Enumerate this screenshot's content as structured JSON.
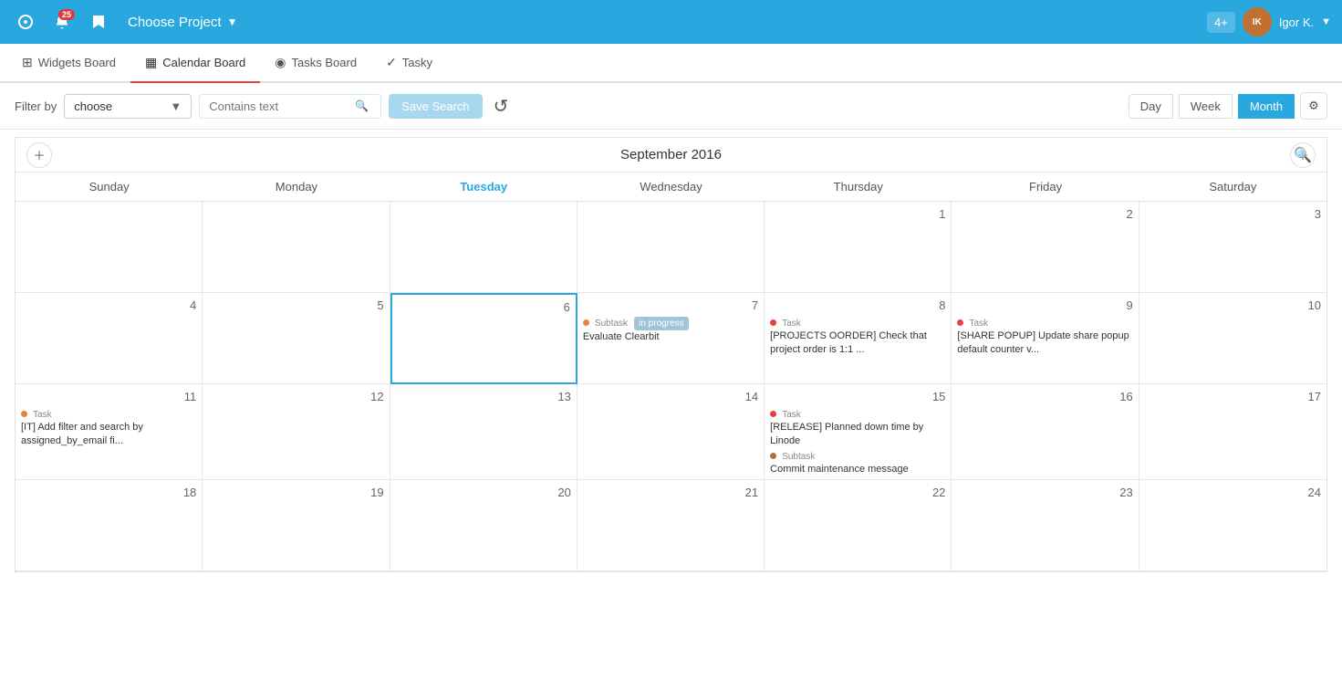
{
  "topNav": {
    "appIconLabel": "◎",
    "notificationIconLabel": "🔔",
    "notificationCount": "25",
    "bookmarkIconLabel": "🔖",
    "projectLabel": "Choose Project",
    "projectArrow": "▼",
    "plusLabel": "4+",
    "userName": "Igor K.",
    "userArrow": "▼"
  },
  "tabs": [
    {
      "id": "widgets",
      "label": "Widgets Board",
      "icon": "⊞",
      "active": false
    },
    {
      "id": "calendar",
      "label": "Calendar Board",
      "icon": "▦",
      "active": true
    },
    {
      "id": "tasks",
      "label": "Tasks Board",
      "icon": "◉",
      "active": false
    },
    {
      "id": "tasky",
      "label": "Tasky",
      "icon": "✓",
      "active": false
    }
  ],
  "filterBar": {
    "filterLabel": "Filter by",
    "filterValue": "choose",
    "searchPlaceholder": "Contains text",
    "saveSearchLabel": "Save Search",
    "viewButtons": [
      {
        "id": "day",
        "label": "Day",
        "active": false
      },
      {
        "id": "week",
        "label": "Week",
        "active": false
      },
      {
        "id": "month",
        "label": "Month",
        "active": true
      }
    ],
    "settingsIcon": "⚙"
  },
  "calendar": {
    "title": "September 2016",
    "dayHeaders": [
      "Sunday",
      "Monday",
      "Tuesday",
      "Wednesday",
      "Thursday",
      "Friday",
      "Saturday"
    ],
    "todayDayIndex": 2,
    "weeks": [
      [
        {
          "num": "",
          "tasks": []
        },
        {
          "num": "",
          "tasks": []
        },
        {
          "num": "",
          "tasks": []
        },
        {
          "num": "",
          "tasks": []
        },
        {
          "num": "1",
          "tasks": []
        },
        {
          "num": "2",
          "tasks": []
        },
        {
          "num": "3",
          "tasks": []
        }
      ],
      [
        {
          "num": "4",
          "tasks": []
        },
        {
          "num": "5",
          "tasks": []
        },
        {
          "num": "6",
          "isToday": true,
          "tasks": []
        },
        {
          "num": "7",
          "tasks": [
            {
              "dot": "orange",
              "label": "Subtask",
              "badge": "in progress",
              "text": "Evaluate Clearbit"
            }
          ]
        },
        {
          "num": "8",
          "tasks": [
            {
              "dot": "red",
              "label": "Task",
              "text": "[PROJECTS OORDER] Check that project order is 1:1 ..."
            }
          ]
        },
        {
          "num": "9",
          "tasks": [
            {
              "dot": "red",
              "label": "Task",
              "text": "[SHARE POPUP] Update share popup default counter v..."
            }
          ]
        },
        {
          "num": "10",
          "tasks": []
        }
      ],
      [
        {
          "num": "11",
          "tasks": [
            {
              "dot": "orange",
              "label": "Task",
              "text": "[IT] Add filter and search by assigned_by_email fi..."
            }
          ]
        },
        {
          "num": "12",
          "tasks": []
        },
        {
          "num": "13",
          "tasks": []
        },
        {
          "num": "14",
          "tasks": []
        },
        {
          "num": "15",
          "tasks": [
            {
              "dot": "red",
              "label": "Task",
              "text": "[RELEASE] Planned down time by Linode"
            },
            {
              "dot": "brown",
              "label": "Subtask",
              "text": "Commit maintenance message"
            }
          ]
        },
        {
          "num": "16",
          "tasks": []
        },
        {
          "num": "17",
          "tasks": []
        }
      ],
      [
        {
          "num": "18",
          "tasks": []
        },
        {
          "num": "19",
          "tasks": []
        },
        {
          "num": "20",
          "tasks": []
        },
        {
          "num": "21",
          "tasks": []
        },
        {
          "num": "22",
          "tasks": []
        },
        {
          "num": "23",
          "tasks": []
        },
        {
          "num": "24",
          "tasks": []
        }
      ]
    ]
  }
}
